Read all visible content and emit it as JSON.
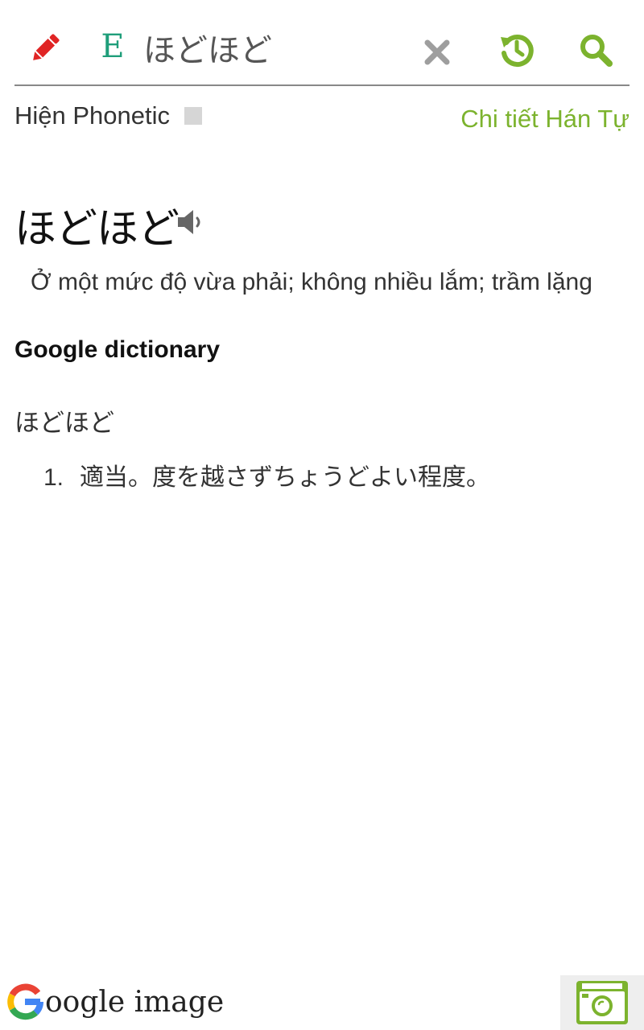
{
  "search": {
    "lang_badge": "E",
    "query": "ほどほど"
  },
  "options": {
    "show_phonetic_label": "Hiện Phonetic",
    "show_phonetic_checked": false,
    "han_tu_link": "Chi tiết Hán Tự"
  },
  "entry": {
    "word": "ほどほど",
    "meaning": "Ở một mức độ vừa phải; không nhiều lắm; trầm lặng"
  },
  "google_dictionary": {
    "title": "Google dictionary",
    "word": "ほどほど",
    "definitions": [
      {
        "number": "1.",
        "text": "適当。度を越さずちょうどよい程度。"
      }
    ]
  },
  "footer": {
    "google_image_label": "oogle image"
  },
  "colors": {
    "accent_green": "#7cb32e",
    "pencil_red": "#e02424",
    "lang_teal": "#1f9e7a",
    "clear_gray": "#9e9e9e"
  }
}
